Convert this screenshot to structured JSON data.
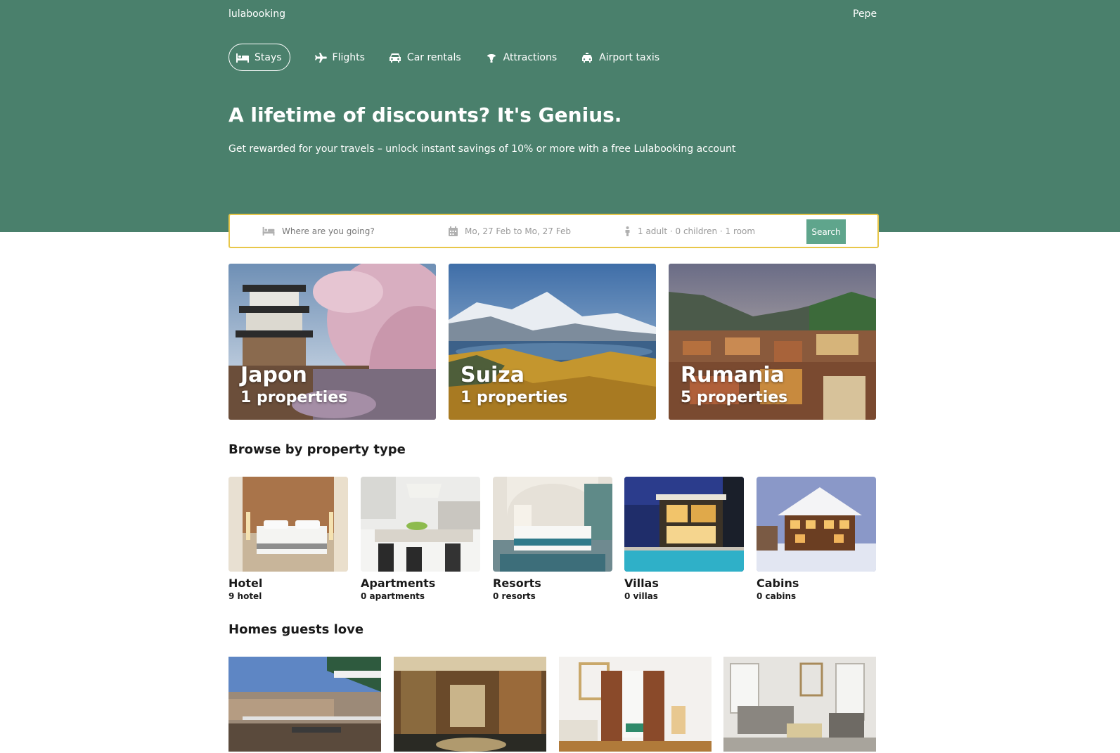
{
  "header": {
    "logo": "lulabooking",
    "user": "Pepe",
    "nav": [
      {
        "label": "Stays",
        "icon": "bed-icon",
        "active": true
      },
      {
        "label": "Flights",
        "icon": "plane-icon",
        "active": false
      },
      {
        "label": "Car rentals",
        "icon": "car-icon",
        "active": false
      },
      {
        "label": "Attractions",
        "icon": "attraction-icon",
        "active": false
      },
      {
        "label": "Airport taxis",
        "icon": "taxi-icon",
        "active": false
      }
    ],
    "title": "A lifetime of discounts? It's Genius.",
    "subtitle": "Get rewarded for your travels – unlock instant savings of 10% or more with a free Lulabooking account"
  },
  "search": {
    "destination_placeholder": "Where are you going?",
    "dates": "Mo, 27 Feb to Mo, 27 Feb",
    "guests": "1 adult · 0 children · 1 room",
    "button": "Search"
  },
  "featured": [
    {
      "name": "Japon",
      "count": "1 properties"
    },
    {
      "name": "Suiza",
      "count": "1 properties"
    },
    {
      "name": "Rumania",
      "count": "5 properties"
    }
  ],
  "property_types": {
    "title": "Browse by property type",
    "items": [
      {
        "name": "Hotel",
        "count": "9 hotel"
      },
      {
        "name": "Apartments",
        "count": "0 apartments"
      },
      {
        "name": "Resorts",
        "count": "0 resorts"
      },
      {
        "name": "Villas",
        "count": "0 villas"
      },
      {
        "name": "Cabins",
        "count": "0 cabins"
      }
    ]
  },
  "homes": {
    "title": "Homes guests love"
  },
  "colors": {
    "header_bg": "#4a806c",
    "search_border": "#e8c74a",
    "search_button": "#5fa58c"
  }
}
